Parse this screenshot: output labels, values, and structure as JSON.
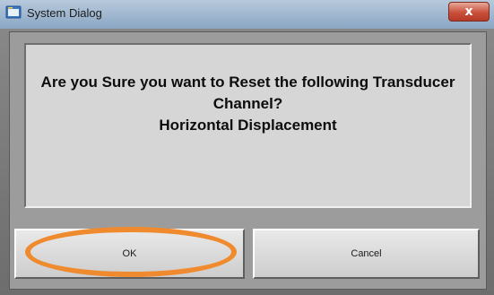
{
  "window": {
    "title": "System Dialog",
    "close_label": "x"
  },
  "dialog": {
    "message_line1": "Are you Sure you want to Reset the following Transducer",
    "message_line2": "Channel?",
    "message_line3": "Horizontal Displacement"
  },
  "buttons": {
    "ok_label": "OK",
    "cancel_label": "Cancel"
  },
  "icons": {
    "app": "app-window-icon",
    "close": "close-icon"
  },
  "colors": {
    "highlight": "#ef8a2e",
    "close_button": "#c9503c"
  }
}
